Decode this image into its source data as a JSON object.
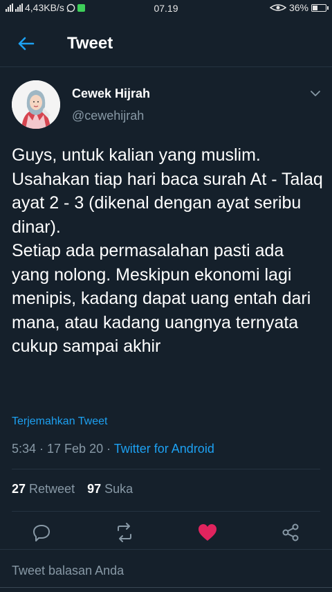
{
  "status_bar": {
    "network_speed": "4,43KB/s",
    "time": "07.19",
    "battery": "36%",
    "battery_level": 0.36
  },
  "header": {
    "title": "Tweet"
  },
  "tweet": {
    "author_name": "Cewek Hijrah",
    "author_handle": "@cewehijrah",
    "text_paragraphs": [
      "Guys, untuk kalian yang muslim. Usahakan tiap hari baca surah At - Talaq ayat 2 - 3 (dikenal dengan ayat seribu dinar).",
      "Setiap ada permasalahan pasti ada yang nolong. Meskipun ekonomi lagi menipis, kadang dapat uang entah dari mana, atau kadang uangnya ternyata cukup sampai akhir"
    ],
    "translate_label": "Terjemahkan Tweet",
    "timestamp": "5:34 · 17 Feb 20 · ",
    "source": "Twitter for Android",
    "retweet_count": "27",
    "retweet_label": "Retweet",
    "like_count": "97",
    "like_label": "Suka"
  },
  "reply": {
    "placeholder": "Tweet balasan Anda"
  },
  "colors": {
    "background": "#15202b",
    "accent": "#1da1f2",
    "secondary_text": "#8899a6",
    "like": "#e0245e"
  },
  "icons": {
    "back": "arrow-left-icon",
    "more": "chevron-down-icon",
    "reply": "comment-icon",
    "retweet": "retweet-icon",
    "like": "heart-icon",
    "share": "share-icon"
  }
}
